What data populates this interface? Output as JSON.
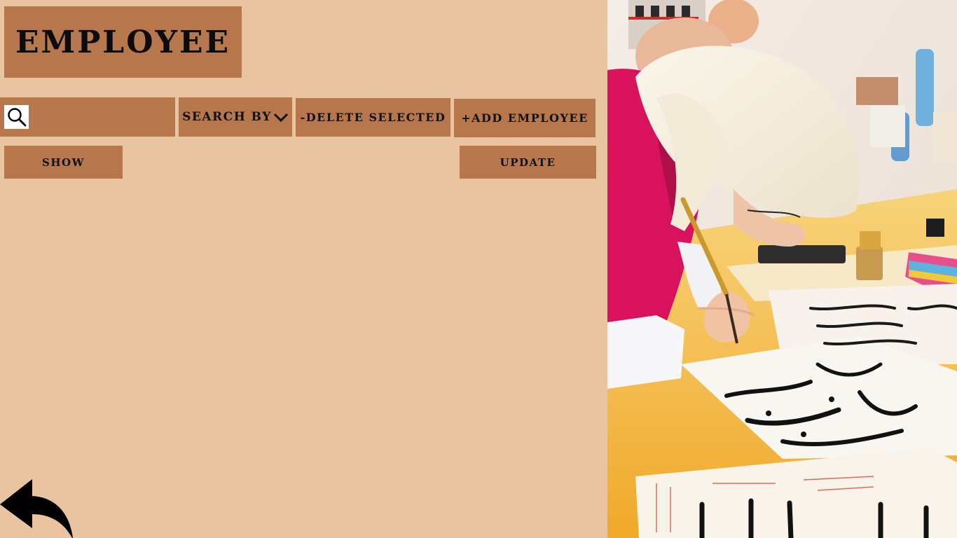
{
  "header": {
    "title": "EMPLOYEE"
  },
  "toolbar": {
    "search_placeholder": "",
    "search_value": "",
    "search_by_label": "SEARCH BY",
    "delete_label": "-DELETE SELECTED",
    "add_label": "+ADD EMPLOYEE",
    "show_label": "SHOW",
    "update_label": "UPDATE"
  },
  "icons": {
    "search": "search-icon",
    "dropdown": "chevron-down-icon",
    "back": "back-arrow-icon"
  },
  "colors": {
    "background": "#e8c4a1",
    "button": "#b5774b",
    "text": "#111111"
  }
}
